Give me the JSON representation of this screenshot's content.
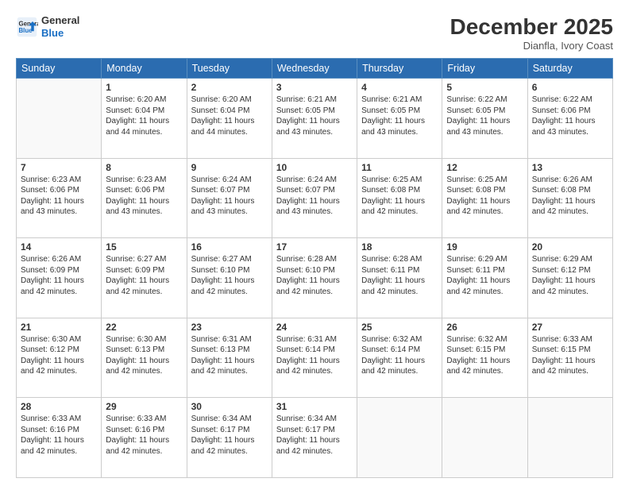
{
  "header": {
    "logo_line1": "General",
    "logo_line2": "Blue",
    "month": "December 2025",
    "location": "Dianfla, Ivory Coast"
  },
  "days_of_week": [
    "Sunday",
    "Monday",
    "Tuesday",
    "Wednesday",
    "Thursday",
    "Friday",
    "Saturday"
  ],
  "weeks": [
    [
      {
        "day": "",
        "info": ""
      },
      {
        "day": "1",
        "info": "Sunrise: 6:20 AM\nSunset: 6:04 PM\nDaylight: 11 hours\nand 44 minutes."
      },
      {
        "day": "2",
        "info": "Sunrise: 6:20 AM\nSunset: 6:04 PM\nDaylight: 11 hours\nand 44 minutes."
      },
      {
        "day": "3",
        "info": "Sunrise: 6:21 AM\nSunset: 6:05 PM\nDaylight: 11 hours\nand 43 minutes."
      },
      {
        "day": "4",
        "info": "Sunrise: 6:21 AM\nSunset: 6:05 PM\nDaylight: 11 hours\nand 43 minutes."
      },
      {
        "day": "5",
        "info": "Sunrise: 6:22 AM\nSunset: 6:05 PM\nDaylight: 11 hours\nand 43 minutes."
      },
      {
        "day": "6",
        "info": "Sunrise: 6:22 AM\nSunset: 6:06 PM\nDaylight: 11 hours\nand 43 minutes."
      }
    ],
    [
      {
        "day": "7",
        "info": "Sunrise: 6:23 AM\nSunset: 6:06 PM\nDaylight: 11 hours\nand 43 minutes."
      },
      {
        "day": "8",
        "info": "Sunrise: 6:23 AM\nSunset: 6:06 PM\nDaylight: 11 hours\nand 43 minutes."
      },
      {
        "day": "9",
        "info": "Sunrise: 6:24 AM\nSunset: 6:07 PM\nDaylight: 11 hours\nand 43 minutes."
      },
      {
        "day": "10",
        "info": "Sunrise: 6:24 AM\nSunset: 6:07 PM\nDaylight: 11 hours\nand 43 minutes."
      },
      {
        "day": "11",
        "info": "Sunrise: 6:25 AM\nSunset: 6:08 PM\nDaylight: 11 hours\nand 42 minutes."
      },
      {
        "day": "12",
        "info": "Sunrise: 6:25 AM\nSunset: 6:08 PM\nDaylight: 11 hours\nand 42 minutes."
      },
      {
        "day": "13",
        "info": "Sunrise: 6:26 AM\nSunset: 6:08 PM\nDaylight: 11 hours\nand 42 minutes."
      }
    ],
    [
      {
        "day": "14",
        "info": "Sunrise: 6:26 AM\nSunset: 6:09 PM\nDaylight: 11 hours\nand 42 minutes."
      },
      {
        "day": "15",
        "info": "Sunrise: 6:27 AM\nSunset: 6:09 PM\nDaylight: 11 hours\nand 42 minutes."
      },
      {
        "day": "16",
        "info": "Sunrise: 6:27 AM\nSunset: 6:10 PM\nDaylight: 11 hours\nand 42 minutes."
      },
      {
        "day": "17",
        "info": "Sunrise: 6:28 AM\nSunset: 6:10 PM\nDaylight: 11 hours\nand 42 minutes."
      },
      {
        "day": "18",
        "info": "Sunrise: 6:28 AM\nSunset: 6:11 PM\nDaylight: 11 hours\nand 42 minutes."
      },
      {
        "day": "19",
        "info": "Sunrise: 6:29 AM\nSunset: 6:11 PM\nDaylight: 11 hours\nand 42 minutes."
      },
      {
        "day": "20",
        "info": "Sunrise: 6:29 AM\nSunset: 6:12 PM\nDaylight: 11 hours\nand 42 minutes."
      }
    ],
    [
      {
        "day": "21",
        "info": "Sunrise: 6:30 AM\nSunset: 6:12 PM\nDaylight: 11 hours\nand 42 minutes."
      },
      {
        "day": "22",
        "info": "Sunrise: 6:30 AM\nSunset: 6:13 PM\nDaylight: 11 hours\nand 42 minutes."
      },
      {
        "day": "23",
        "info": "Sunrise: 6:31 AM\nSunset: 6:13 PM\nDaylight: 11 hours\nand 42 minutes."
      },
      {
        "day": "24",
        "info": "Sunrise: 6:31 AM\nSunset: 6:14 PM\nDaylight: 11 hours\nand 42 minutes."
      },
      {
        "day": "25",
        "info": "Sunrise: 6:32 AM\nSunset: 6:14 PM\nDaylight: 11 hours\nand 42 minutes."
      },
      {
        "day": "26",
        "info": "Sunrise: 6:32 AM\nSunset: 6:15 PM\nDaylight: 11 hours\nand 42 minutes."
      },
      {
        "day": "27",
        "info": "Sunrise: 6:33 AM\nSunset: 6:15 PM\nDaylight: 11 hours\nand 42 minutes."
      }
    ],
    [
      {
        "day": "28",
        "info": "Sunrise: 6:33 AM\nSunset: 6:16 PM\nDaylight: 11 hours\nand 42 minutes."
      },
      {
        "day": "29",
        "info": "Sunrise: 6:33 AM\nSunset: 6:16 PM\nDaylight: 11 hours\nand 42 minutes."
      },
      {
        "day": "30",
        "info": "Sunrise: 6:34 AM\nSunset: 6:17 PM\nDaylight: 11 hours\nand 42 minutes."
      },
      {
        "day": "31",
        "info": "Sunrise: 6:34 AM\nSunset: 6:17 PM\nDaylight: 11 hours\nand 42 minutes."
      },
      {
        "day": "",
        "info": ""
      },
      {
        "day": "",
        "info": ""
      },
      {
        "day": "",
        "info": ""
      }
    ]
  ]
}
